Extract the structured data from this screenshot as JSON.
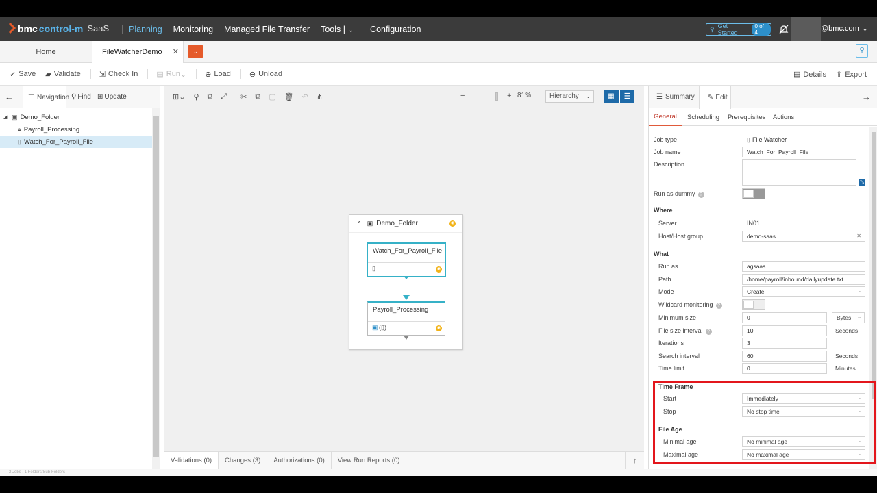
{
  "header": {
    "brand_bmc": "bmc",
    "brand_product": "control-m",
    "brand_saas": "SaaS",
    "nav": [
      {
        "label": "Planning",
        "active": true
      },
      {
        "label": "Monitoring"
      },
      {
        "label": "Managed File Transfer"
      },
      {
        "label": "Tools |"
      },
      {
        "label": "Configuration"
      }
    ],
    "get_started": "Get Started",
    "get_started_count": "0 of 4",
    "user_email": "@bmc.com"
  },
  "tabs": {
    "home": "Home",
    "active": "FileWatcherDemo"
  },
  "actions": {
    "save": "Save",
    "validate": "Validate",
    "checkin": "Check In",
    "run": "Run",
    "load": "Load",
    "unload": "Unload",
    "details": "Details",
    "export": "Export"
  },
  "left": {
    "tabs": {
      "navigation": "Navigation",
      "find": "Find",
      "update": "Update"
    },
    "tree": [
      {
        "label": "Demo_Folder"
      },
      {
        "label": "Payroll_Processing"
      },
      {
        "label": "Watch_For_Payroll_File"
      }
    ]
  },
  "canvas": {
    "zoom": "81%",
    "view_mode": "Hierarchy",
    "folder": "Demo_Folder",
    "job1": "Watch_For_Payroll_File",
    "job2": "Payroll_Processing"
  },
  "bottom_tabs": {
    "validations": "Validations (0)",
    "changes": "Changes (3)",
    "authorizations": "Authorizations (0)",
    "run_reports": "View Run Reports (0)"
  },
  "right": {
    "tabs": {
      "summary": "Summary",
      "edit": "Edit"
    },
    "subtabs": {
      "general": "General",
      "scheduling": "Scheduling",
      "prerequisites": "Prerequisites",
      "actions": "Actions"
    },
    "fields": {
      "job_type_label": "Job type",
      "job_type": "File Watcher",
      "job_name_label": "Job name",
      "job_name": "Watch_For_Payroll_File",
      "description_label": "Description",
      "dummy_label": "Run as dummy",
      "where": "Where",
      "server_label": "Server",
      "server": "IN01",
      "host_label": "Host/Host group",
      "host": "demo-saas",
      "what": "What",
      "runas_label": "Run as",
      "runas": "agsaas",
      "path_label": "Path",
      "path": "/home/payroll/inbound/dailyupdate.txt",
      "mode_label": "Mode",
      "mode": "Create",
      "wildcard_label": "Wildcard monitoring",
      "minsize_label": "Minimum size",
      "minsize": "0",
      "minsize_unit": "Bytes",
      "fsi_label": "File size interval",
      "fsi": "10",
      "fsi_unit": "Seconds",
      "iter_label": "Iterations",
      "iter": "3",
      "search_label": "Search interval",
      "search": "60",
      "search_unit": "Seconds",
      "timelimit_label": "Time limit",
      "timelimit": "0",
      "timelimit_unit": "Minutes",
      "timeframe": "Time Frame",
      "start_label": "Start",
      "start": "Immediately",
      "stop_label": "Stop",
      "stop": "No stop time",
      "fileage": "File Age",
      "minage_label": "Minimal age",
      "minage": "No minimal age",
      "maxage_label": "Maximal age",
      "maxage": "No maximal age"
    }
  },
  "status": "2 Jobs , 1 Folders/Sub-Folders",
  "colors": {
    "header_bg": "#3b3b3b",
    "accent": "#6cbde9",
    "job_border": "#36b1c7",
    "highlight": "#e3161c",
    "orange": "#e55a2a"
  }
}
